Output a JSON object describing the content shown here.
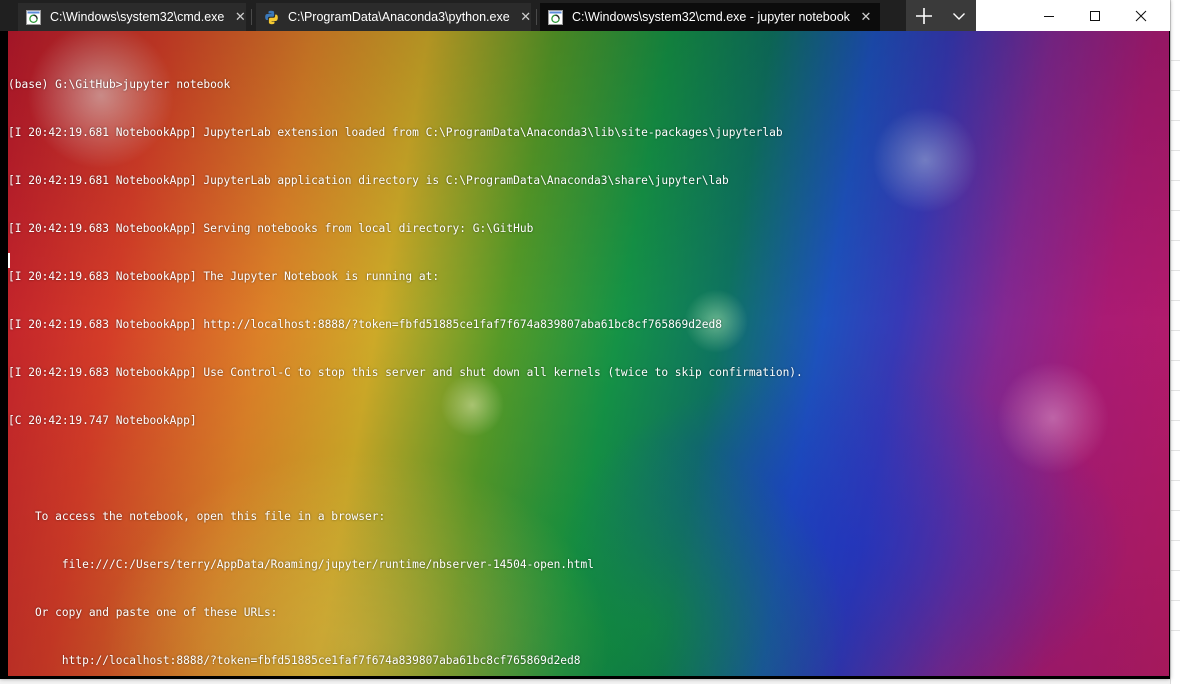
{
  "tabs": [
    {
      "title": "C:\\Windows\\system32\\cmd.exe",
      "icon": "cmd-icon",
      "active": false
    },
    {
      "title": "C:\\ProgramData\\Anaconda3\\python.exe",
      "icon": "python-icon",
      "active": false
    },
    {
      "title": "C:\\Windows\\system32\\cmd.exe - jupyter  notebook",
      "icon": "cmd-icon",
      "active": true
    }
  ],
  "terminal": {
    "lines": [
      "(base) G:\\GitHub>jupyter notebook",
      "[I 20:42:19.681 NotebookApp] JupyterLab extension loaded from C:\\ProgramData\\Anaconda3\\lib\\site-packages\\jupyterlab",
      "[I 20:42:19.681 NotebookApp] JupyterLab application directory is C:\\ProgramData\\Anaconda3\\share\\jupyter\\lab",
      "[I 20:42:19.683 NotebookApp] Serving notebooks from local directory: G:\\GitHub",
      "[I 20:42:19.683 NotebookApp] The Jupyter Notebook is running at:",
      "[I 20:42:19.683 NotebookApp] http://localhost:8888/?token=fbfd51885ce1faf7f674a839807aba61bc8cf765869d2ed8",
      "[I 20:42:19.683 NotebookApp] Use Control-C to stop this server and shut down all kernels (twice to skip confirmation).",
      "[C 20:42:19.747 NotebookApp]",
      "",
      "    To access the notebook, open this file in a browser:",
      "        file:///C:/Users/terry/AppData/Roaming/jupyter/runtime/nbserver-14504-open.html",
      "    Or copy and paste one of these URLs:",
      "        http://localhost:8888/?token=fbfd51885ce1faf7f674a839807aba61bc8cf765869d2ed8"
    ]
  },
  "colors": {
    "tabstrip": "#202020",
    "active_tab": "#0c0c0c",
    "terminal_text": "#ffffff"
  }
}
